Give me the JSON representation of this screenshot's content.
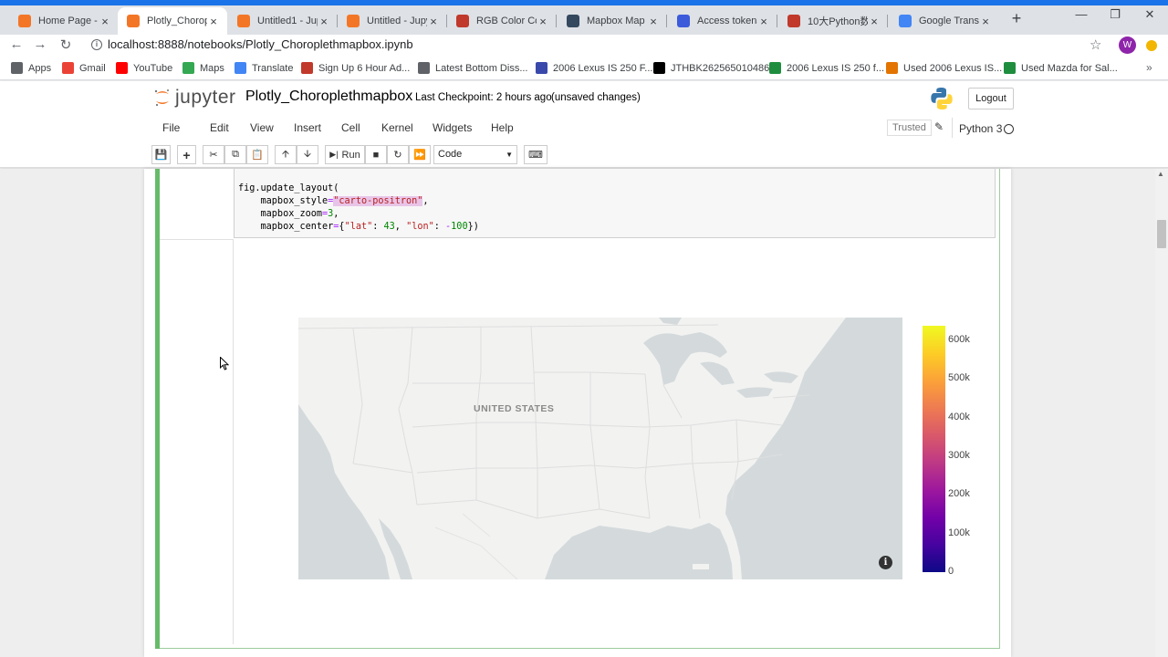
{
  "browser": {
    "tabs": [
      {
        "title": "Home Page - S",
        "favicon_color": "#f37626",
        "active": false
      },
      {
        "title": "Plotly_Choropl",
        "favicon_color": "#f37626",
        "active": true
      },
      {
        "title": "Untitled1 - Jup",
        "favicon_color": "#f37626",
        "active": false
      },
      {
        "title": "Untitled - Jupy",
        "favicon_color": "#f37626",
        "active": false
      },
      {
        "title": "RGB Color Cod",
        "favicon_color": "#c0392b",
        "active": false
      },
      {
        "title": "Mapbox Map L",
        "favicon_color": "#34495e",
        "active": false
      },
      {
        "title": "Access tokens",
        "favicon_color": "#3b5bdb",
        "active": false
      },
      {
        "title": "10大Python数",
        "favicon_color": "#c0392b",
        "active": false
      },
      {
        "title": "Google Transla",
        "favicon_color": "#4285f4",
        "active": false
      }
    ],
    "url": "localhost:8888/notebooks/Plotly_Choroplethmapbox.ipynb",
    "profile_initial": "W",
    "bookmarks": [
      {
        "label": "Apps",
        "icon": "apps-grid-icon",
        "color": "#5f6368"
      },
      {
        "label": "Gmail",
        "icon": "gmail-icon",
        "color": "#ea4335"
      },
      {
        "label": "YouTube",
        "icon": "youtube-icon",
        "color": "#ff0000"
      },
      {
        "label": "Maps",
        "icon": "maps-pin-icon",
        "color": "#34a853"
      },
      {
        "label": "Translate",
        "icon": "translate-icon",
        "color": "#4285f4"
      },
      {
        "label": "Sign Up 6 Hour Ad...",
        "icon": "flag-icon",
        "color": "#c0392b"
      },
      {
        "label": "Latest Bottom Diss...",
        "icon": "globe-icon",
        "color": "#5f6368"
      },
      {
        "label": "2006 Lexus IS 250 F...",
        "icon": "car-icon",
        "color": "#3949ab"
      },
      {
        "label": "JTHBK262565010486...",
        "icon": "c-icon",
        "color": "#000000"
      },
      {
        "label": "2006 Lexus IS 250 f...",
        "icon": "up-arrow-icon",
        "color": "#1e8e3e"
      },
      {
        "label": "Used 2006 Lexus IS...",
        "icon": "cars-icon",
        "color": "#e37400"
      },
      {
        "label": "Used Mazda for Sal...",
        "icon": "up-arrow-icon",
        "color": "#1e8e3e"
      }
    ]
  },
  "jupyter": {
    "logo_text": "jupyter",
    "notebook_name": "Plotly_Choroplethmapbox",
    "checkpoint": "Last Checkpoint: 2 hours ago",
    "unsaved": "(unsaved changes)",
    "logout": "Logout",
    "menu": [
      "File",
      "Edit",
      "View",
      "Insert",
      "Cell",
      "Kernel",
      "Widgets",
      "Help"
    ],
    "trusted": "Trusted",
    "kernel_name": "Python 3",
    "toolbar": {
      "run_label": "Run",
      "cell_type": "Code"
    }
  },
  "cell": {
    "code_lines": [
      "fig.update_layout(",
      "    mapbox_style=\"carto-positron\",",
      "    mapbox_zoom=3,",
      "    mapbox_center={\"lat\": 43, \"lon\": -100})"
    ]
  },
  "output": {
    "map_label": "UNITED STATES",
    "colorbar_ticks": [
      "600k",
      "500k",
      "400k",
      "300k",
      "200k",
      "100k",
      "0"
    ],
    "colorscale": [
      "#0d0887",
      "#7201a8",
      "#bd3786",
      "#ed7953",
      "#fdca26",
      "#f0f921"
    ]
  }
}
